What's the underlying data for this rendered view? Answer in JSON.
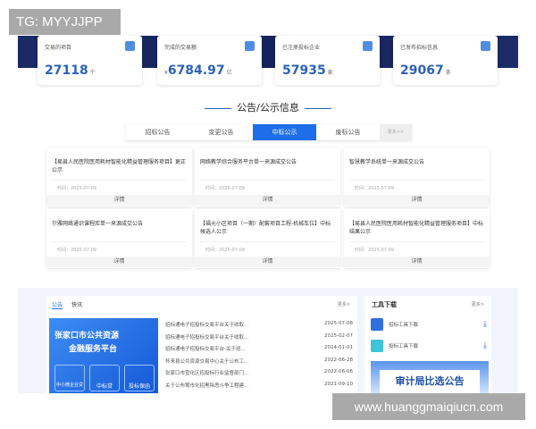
{
  "watermark_top": "TG: MYYJJPP",
  "watermark_bottom": "www.huanggmaiqiucn.com",
  "stats": [
    {
      "label": "交易的项目",
      "value": "27118",
      "unit": "个",
      "prefix": "",
      "icon": "monitor-icon"
    },
    {
      "label": "完成的交易额",
      "value": "6784.97",
      "unit": "亿",
      "prefix": "¥",
      "icon": "money-bag-icon"
    },
    {
      "label": "已注册投标企业",
      "value": "57935",
      "unit": "家",
      "prefix": "",
      "icon": "user-icon"
    },
    {
      "label": "已发布招标信息",
      "value": "29067",
      "unit": "条",
      "prefix": "",
      "icon": "document-icon"
    }
  ],
  "section_title": "公告/公示信息",
  "tabs": [
    "招标公告",
    "变更公告",
    "中标公示",
    "废标公告"
  ],
  "tabs_more": "更多>>",
  "active_tab": "中标公示",
  "notices": [
    {
      "title": "【易县人民医院医用耗材智能化精益管理服务项目】更正公示",
      "date": "时间：2025-07-09",
      "button": "详情"
    },
    {
      "title": "网络教学综合服务平台单一来源成交公告",
      "date": "时间：2025-07-09",
      "button": "详情"
    },
    {
      "title": "智慧教学系统单一来源成交公告",
      "date": "时间：2025-07-09",
      "button": "详情"
    },
    {
      "title": "尔雅网络通识课程库单一来源成交公告",
      "date": "时间：2025-07-09",
      "button": "详情"
    },
    {
      "title": "【福元小区项目（一期）配套项目工程-机械车位】中标候选人公示",
      "date": "时间：2025-07-09",
      "button": "详情"
    },
    {
      "title": "【易县人民医院医用耗材智能化精益管理服务项目】中标结果公示",
      "date": "时间：2025-07-09",
      "button": "详情"
    }
  ],
  "bottom": {
    "tabs": [
      "公告",
      "快讯"
    ],
    "more": "更多>",
    "promo": {
      "title1": "张家口市公共资源",
      "title2": "金融服务平台",
      "buttons": [
        "中小微企业贷",
        "中标贷",
        "投标保函"
      ]
    },
    "news": [
      {
        "title": "招标通电子招投标交易平台关于收取...",
        "date": "2025-07-08"
      },
      {
        "title": "招标通电子招投标交易平台关于收取...",
        "date": "2025-02-07"
      },
      {
        "title": "招标通电子招投标交易平台-关于班...",
        "date": "2024-01-01"
      },
      {
        "title": "怀来县公共资源交易中心关于公布工...",
        "date": "2022-06-28"
      },
      {
        "title": "张家口市宣化区招投标行业监督部门...",
        "date": "2022-06-06"
      },
      {
        "title": "关于公布莺市化招黑除恶斗争工程建...",
        "date": "2021-09-10"
      }
    ],
    "tools_title": "工具下载",
    "tools_more": "更多>",
    "tools": [
      {
        "label": "招标工具下载",
        "color": "#2f6fe0"
      },
      {
        "label": "投标工具下载",
        "color": "#3cc6d8"
      }
    ],
    "audit_banner": "审计局比选公告"
  }
}
